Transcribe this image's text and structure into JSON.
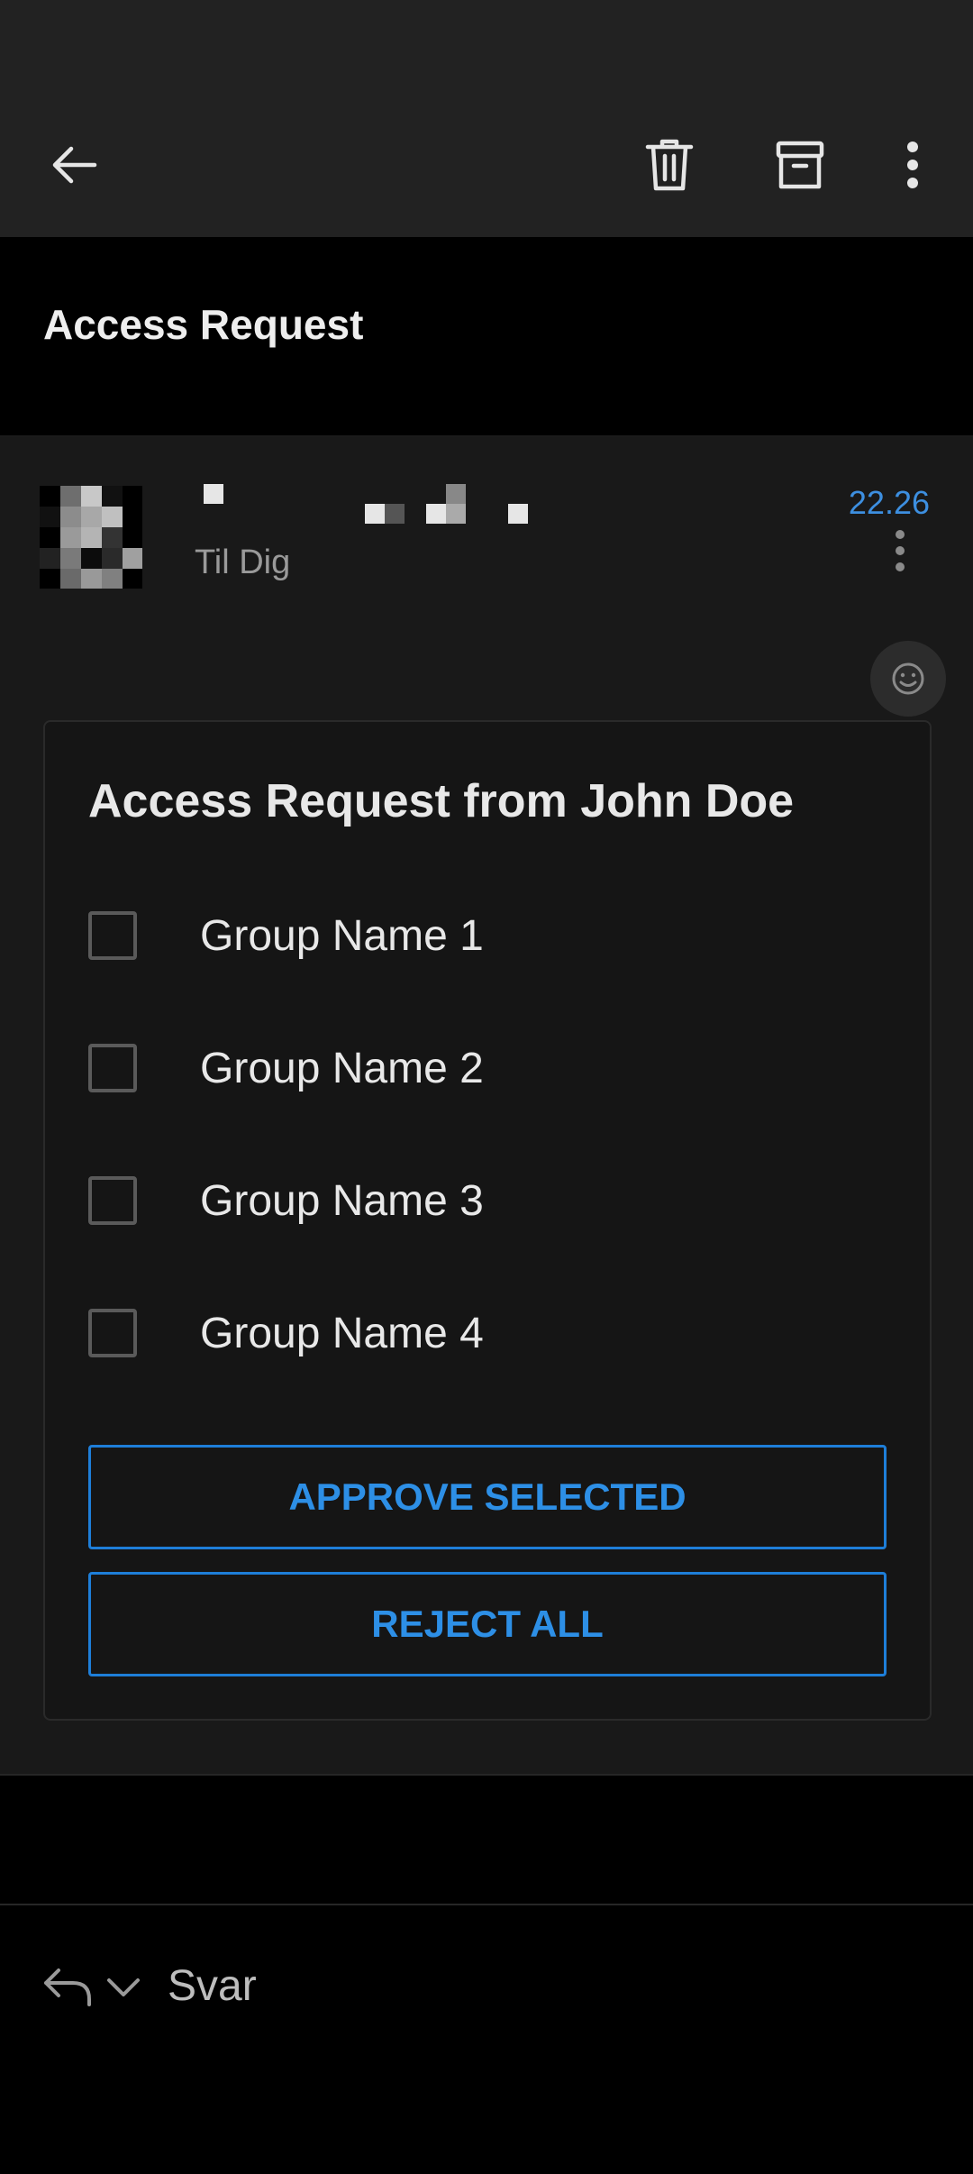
{
  "toolbar": {
    "back_icon": "arrow-left-icon",
    "delete_icon": "trash-icon",
    "archive_icon": "archive-icon",
    "more_icon": "more-vertical-icon"
  },
  "subject": "Access Request",
  "message": {
    "recipient": "Til Dig",
    "time": "22.26",
    "reaction_icon": "smiley-icon",
    "card": {
      "title": "Access Request from John Doe",
      "options": [
        {
          "label": "Group Name 1",
          "checked": false
        },
        {
          "label": "Group Name 2",
          "checked": false
        },
        {
          "label": "Group Name 3",
          "checked": false
        },
        {
          "label": "Group Name 4",
          "checked": false
        }
      ],
      "approve_label": "APPROVE SELECTED",
      "reject_label": "REJECT ALL"
    }
  },
  "reply": {
    "label": "Svar",
    "reply_icon": "reply-icon",
    "expand_icon": "chevron-down-icon"
  },
  "colors": {
    "accent": "#2d8fe6",
    "toolbar_bg": "#222222",
    "message_bg": "#191919"
  }
}
